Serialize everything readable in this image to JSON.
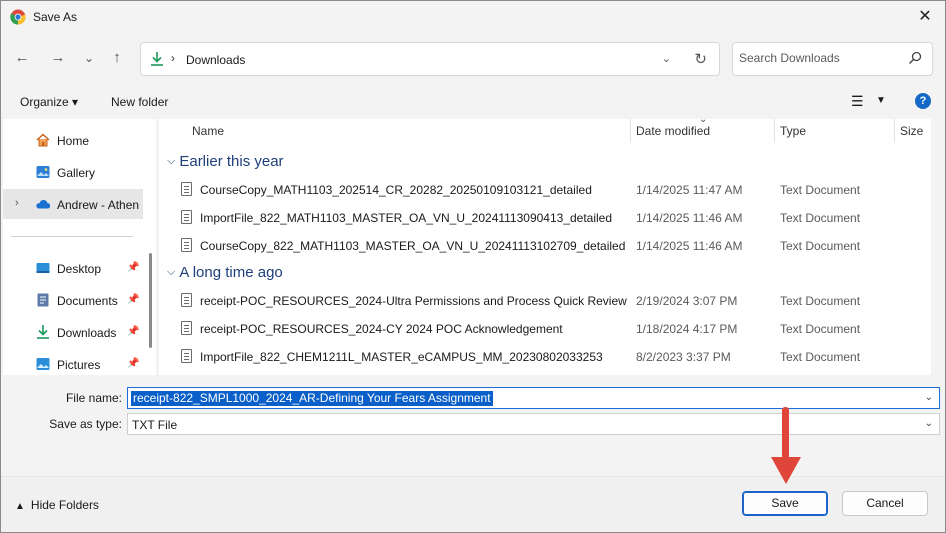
{
  "window": {
    "title": "Save As",
    "close_glyph": "✕",
    "app_icon": "chrome-icon"
  },
  "nav": {
    "back": "←",
    "forward": "→",
    "recent": "⌄",
    "up": "↑",
    "breadcrumb": [
      "Downloads"
    ],
    "crumb_separator": "›",
    "address_dropdown": "⌄",
    "refresh": "↻",
    "search_placeholder": "Search Downloads"
  },
  "commandbar": {
    "organize": "Organize ▾",
    "new_folder": "New folder",
    "view_glyph": "☰",
    "view_dropdown": "▼",
    "help": "?"
  },
  "sidebar": {
    "items": [
      {
        "label": "Home",
        "icon": "home-icon"
      },
      {
        "label": "Gallery",
        "icon": "gallery-icon"
      },
      {
        "label": "Andrew - Athen",
        "icon": "onedrive-cloud-icon",
        "selected": true,
        "expander": "›"
      },
      {
        "label": "Desktop",
        "icon": "desktop-icon",
        "pinned": true
      },
      {
        "label": "Documents",
        "icon": "documents-icon",
        "pinned": true
      },
      {
        "label": "Downloads",
        "icon": "downloads-icon",
        "pinned": true
      },
      {
        "label": "Pictures",
        "icon": "pictures-icon",
        "pinned": true
      }
    ],
    "pin_glyph": "📌"
  },
  "filelist": {
    "columns": {
      "name": "Name",
      "date": "Date modified",
      "type": "Type",
      "size": "Size"
    },
    "sort_glyph": "⌄",
    "groups": [
      {
        "label": "Earlier this year",
        "files": [
          {
            "name": "CourseCopy_MATH1103_202514_CR_20282_20250109103121_detailed",
            "date": "1/14/2025 11:47 AM",
            "type": "Text Document"
          },
          {
            "name": "ImportFile_822_MATH1103_MASTER_OA_VN_U_20241113090413_detailed",
            "date": "1/14/2025 11:46 AM",
            "type": "Text Document"
          },
          {
            "name": "CourseCopy_822_MATH1103_MASTER_OA_VN_U_20241113102709_detailed",
            "date": "1/14/2025 11:46 AM",
            "type": "Text Document"
          }
        ]
      },
      {
        "label": "A long time ago",
        "files": [
          {
            "name": "receipt-POC_RESOURCES_2024-Ultra Permissions and Process Quick Review",
            "date": "2/19/2024 3:07 PM",
            "type": "Text Document"
          },
          {
            "name": "receipt-POC_RESOURCES_2024-CY 2024 POC Acknowledgement",
            "date": "1/18/2024 4:17 PM",
            "type": "Text Document"
          },
          {
            "name": "ImportFile_822_CHEM1211L_MASTER_eCAMPUS_MM_20230802033253",
            "date": "8/2/2023 3:37 PM",
            "type": "Text Document"
          }
        ]
      }
    ],
    "group_chevron": "⌵"
  },
  "form": {
    "file_name_label": "File name:",
    "file_name_value": "receipt-822_SMPL1000_2024_AR-Defining Your Fears Assignment",
    "save_type_label": "Save as type:",
    "save_type_value": "TXT File",
    "dropdown_glyph": "⌄"
  },
  "footer": {
    "hide_folders": "Hide Folders",
    "hide_glyph": "▲",
    "save": "Save",
    "cancel": "Cancel"
  },
  "colors": {
    "accent": "#0a5fc8",
    "annotation_arrow": "#e0453a",
    "group_header": "#1e3f7a"
  }
}
